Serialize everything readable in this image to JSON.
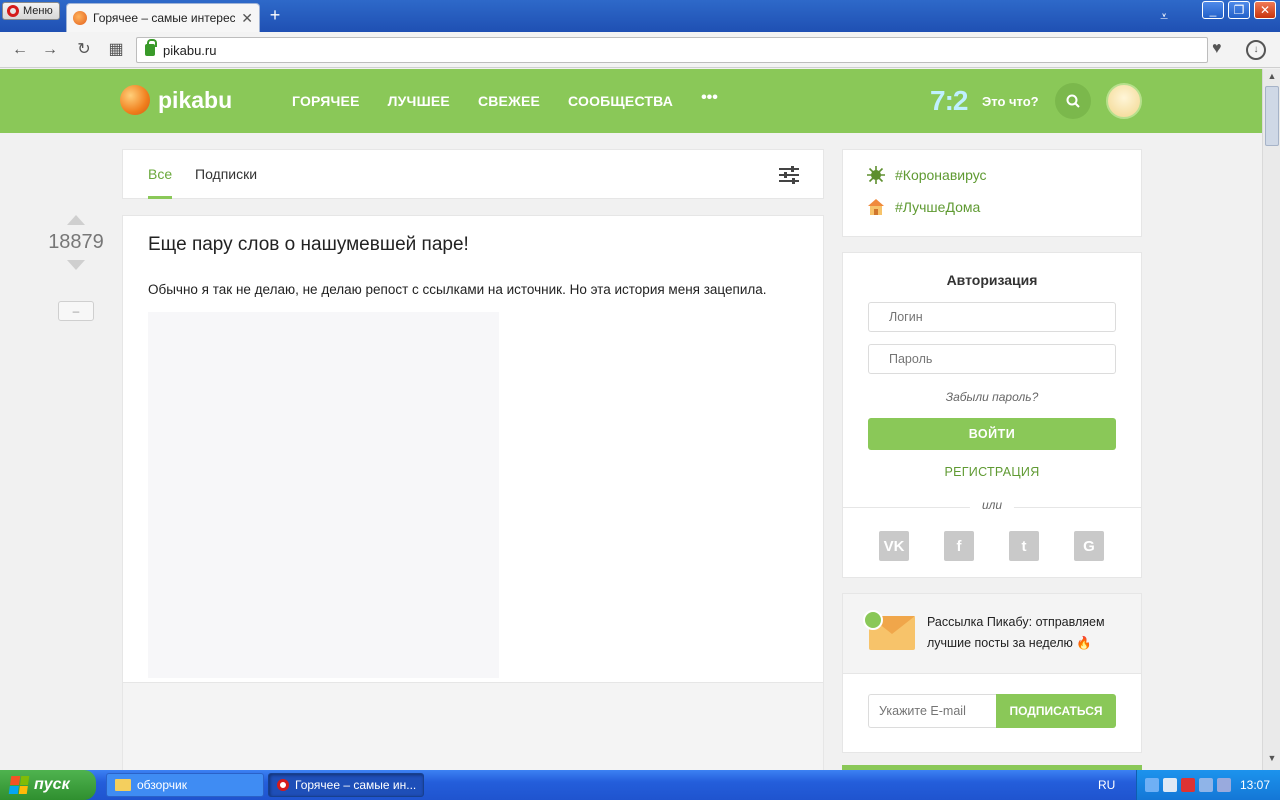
{
  "browser": {
    "menu_label": "Меню",
    "tab_title": "Горячее – самые интересные",
    "tab_close": "✕",
    "new_tab": "+",
    "url": "pikabu.ru"
  },
  "header": {
    "logo_text": "pikabu",
    "nav": [
      "ГОРЯЧЕЕ",
      "ЛУЧШЕЕ",
      "СВЕЖЕЕ",
      "СООБЩЕСТВА"
    ],
    "nav_more": "•••",
    "score": "7:2",
    "score_link": "Это что?"
  },
  "feed_tabs": {
    "all": "Все",
    "subs": "Подписки"
  },
  "post": {
    "rating": "18879",
    "hide_label": "–",
    "title": "Еще пару слов о нашумевшей паре!",
    "text": "Обычно я так не делаю, не делаю репост с ссылками на источник. Но эта история меня зацепила."
  },
  "tags": [
    "#Коронавирус",
    "#ЛучшеДома"
  ],
  "auth": {
    "title": "Авторизация",
    "login_placeholder": "Логин",
    "password_placeholder": "Пароль",
    "forgot": "Забыли пароль?",
    "login_button": "ВОЙТИ",
    "register": "РЕГИСТРАЦИЯ",
    "or": "или",
    "socials": [
      "VK",
      "f",
      "t",
      "G"
    ]
  },
  "newsletter": {
    "text": "Рассылка Пикабу: отправляем лучшие посты за неделю 🔥",
    "email_placeholder": "Укажите E-mail",
    "subscribe_button": "ПОДПИСАТЬСЯ"
  },
  "taskbar": {
    "start_label": "пуск",
    "tasks": [
      "обзорчик",
      "Горячее – самые ин..."
    ],
    "lang": "RU",
    "clock": "13:07"
  },
  "colors": {
    "brand": "#8ac858",
    "link": "#5f9a32"
  }
}
